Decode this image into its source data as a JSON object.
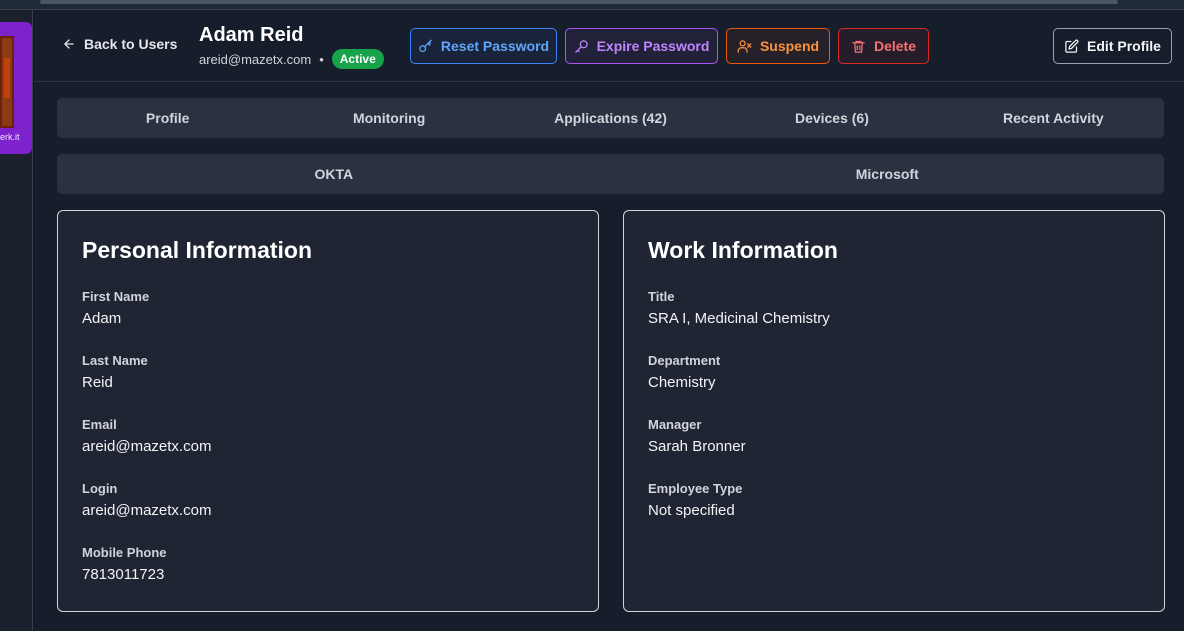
{
  "thumbnail": {
    "caption": "erk.it"
  },
  "header": {
    "back_label": "Back to Users",
    "name": "Adam Reid",
    "email": "areid@mazetx.com",
    "separator": "•",
    "status": "Active"
  },
  "actions": {
    "reset_password": "Reset Password",
    "expire_password": "Expire Password",
    "suspend": "Suspend",
    "delete": "Delete",
    "edit_profile": "Edit Profile"
  },
  "tabs": [
    {
      "label": "Profile"
    },
    {
      "label": "Monitoring"
    },
    {
      "label": "Applications (42)"
    },
    {
      "label": "Devices (6)"
    },
    {
      "label": "Recent Activity"
    }
  ],
  "subtabs": [
    {
      "label": "OKTA"
    },
    {
      "label": "Microsoft"
    }
  ],
  "personal": {
    "title": "Personal Information",
    "fields": [
      {
        "label": "First Name",
        "value": "Adam"
      },
      {
        "label": "Last Name",
        "value": "Reid"
      },
      {
        "label": "Email",
        "value": "areid@mazetx.com"
      },
      {
        "label": "Login",
        "value": "areid@mazetx.com"
      },
      {
        "label": "Mobile Phone",
        "value": "7813011723"
      }
    ]
  },
  "work": {
    "title": "Work Information",
    "fields": [
      {
        "label": "Title",
        "value": "SRA I, Medicinal Chemistry"
      },
      {
        "label": "Department",
        "value": "Chemistry"
      },
      {
        "label": "Manager",
        "value": "Sarah Bronner"
      },
      {
        "label": "Employee Type",
        "value": "Not specified"
      }
    ]
  }
}
